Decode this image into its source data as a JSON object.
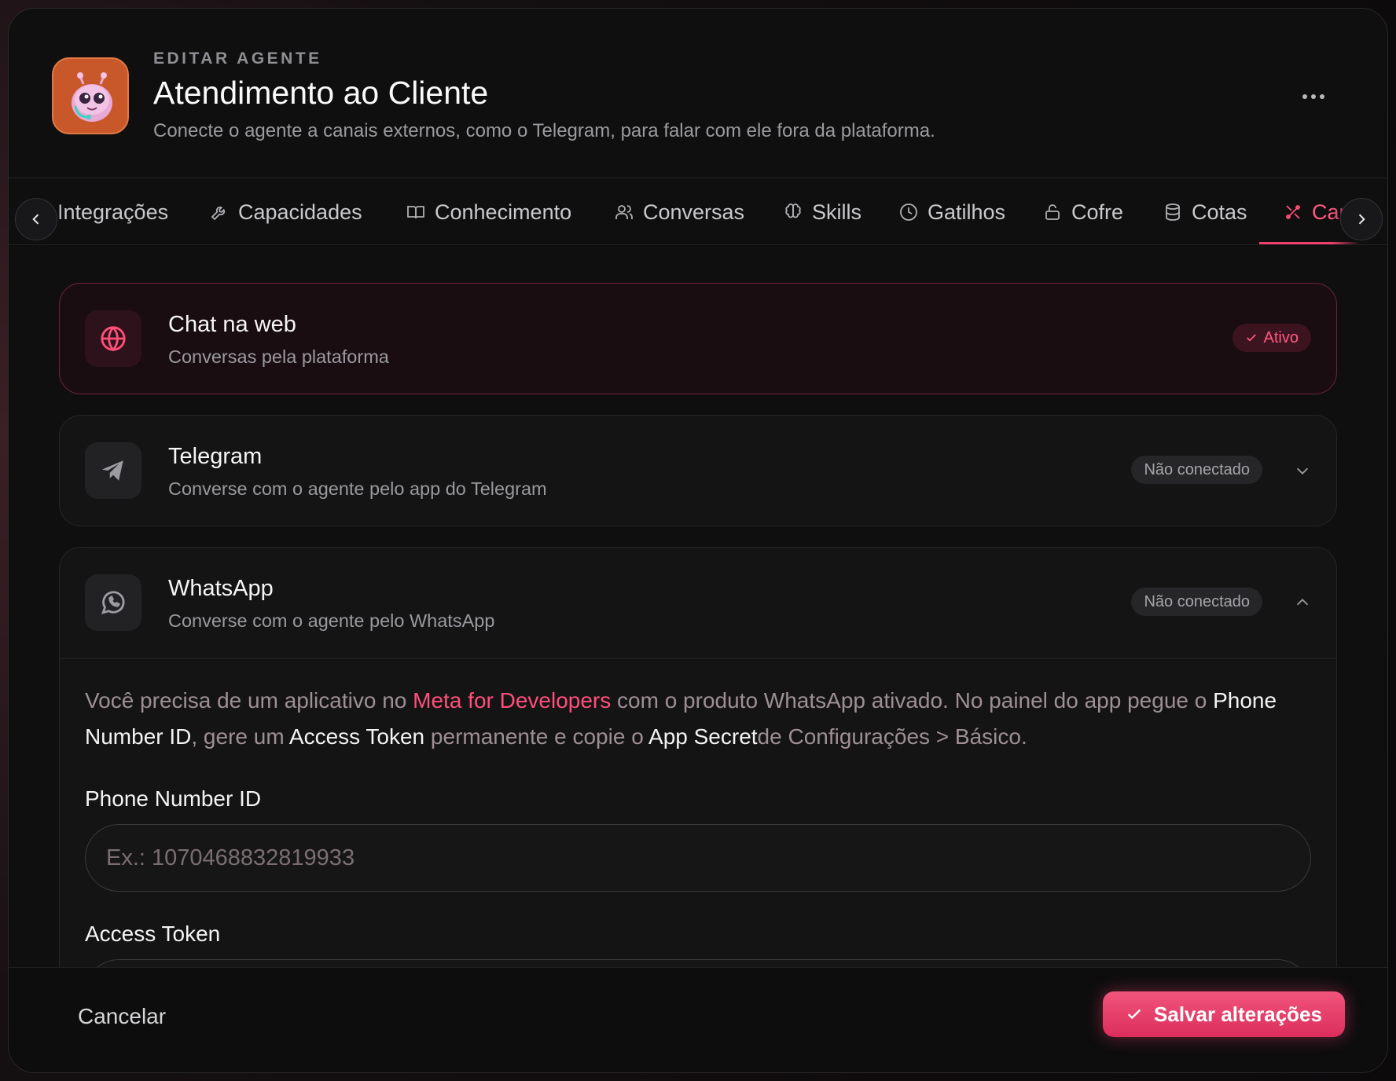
{
  "header": {
    "eyebrow": "EDITAR AGENTE",
    "title": "Atendimento ao Cliente",
    "subtitle": "Conecte o agente a canais externos, como o Telegram, para falar com ele fora da plataforma."
  },
  "tabs": [
    {
      "label": "Integrações",
      "icon": "plug-icon"
    },
    {
      "label": "Capacidades",
      "icon": "wrench-icon"
    },
    {
      "label": "Conhecimento",
      "icon": "book-icon"
    },
    {
      "label": "Conversas",
      "icon": "users-icon"
    },
    {
      "label": "Skills",
      "icon": "brain-icon"
    },
    {
      "label": "Gatilhos",
      "icon": "clock-icon"
    },
    {
      "label": "Cofre",
      "icon": "lock-icon"
    },
    {
      "label": "Cotas",
      "icon": "database-icon"
    },
    {
      "label": "Car",
      "icon": "channels-icon",
      "active": true
    }
  ],
  "channels": {
    "web": {
      "title": "Chat na web",
      "description": "Conversas pela plataforma",
      "status": "Ativo"
    },
    "telegram": {
      "title": "Telegram",
      "description": "Converse com o agente pelo app do Telegram",
      "status": "Não conectado"
    },
    "whatsapp": {
      "title": "WhatsApp",
      "description": "Converse com o agente pelo WhatsApp",
      "status": "Não conectado",
      "info": {
        "p1": "Você precisa de um aplicativo no ",
        "link": "Meta for Developers",
        "p2": " com o produto WhatsApp ativado. No painel do app pegue o ",
        "b1": "Phone Number ID",
        "p3": ", gere um ",
        "b2": "Access Token",
        "p4": " permanente e copie o ",
        "b3": "App Secret",
        "p5": "de Configurações > Básico."
      },
      "phone_label": "Phone Number ID",
      "phone_placeholder": "Ex.: 1070468832819933",
      "token_label": "Access Token"
    }
  },
  "footer": {
    "cancel": "Cancelar",
    "save": "Salvar alterações"
  },
  "colors": {
    "accent": "#ef3f6c",
    "background": "#0f0f10"
  }
}
